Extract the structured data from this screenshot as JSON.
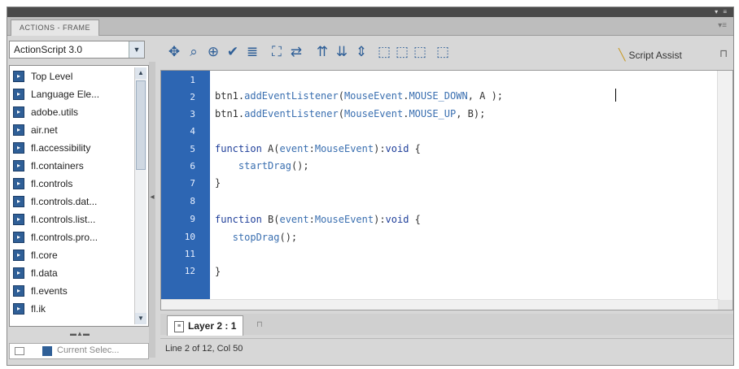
{
  "window": {
    "tab_label": "ACTIONS - FRAME",
    "controls": "▾ ≡",
    "panel_menu": "▾≡"
  },
  "left_panel": {
    "language": "ActionScript 3.0",
    "tree_items": [
      {
        "label": "Top Level"
      },
      {
        "label": "Language Ele..."
      },
      {
        "label": "adobe.utils"
      },
      {
        "label": "air.net"
      },
      {
        "label": "fl.accessibility"
      },
      {
        "label": "fl.containers"
      },
      {
        "label": "fl.controls"
      },
      {
        "label": "fl.controls.dat..."
      },
      {
        "label": "fl.controls.list..."
      },
      {
        "label": "fl.controls.pro..."
      },
      {
        "label": "fl.core"
      },
      {
        "label": "fl.data"
      },
      {
        "label": "fl.events"
      },
      {
        "label": "fl.ik"
      }
    ],
    "bottom_item": "Current Selec..."
  },
  "toolbar": {
    "icons": [
      "add-statement-icon",
      "find-icon",
      "insert-target-path-icon",
      "check-syntax-icon",
      "auto-format-icon",
      "show-code-hint-icon",
      "debug-options-icon",
      "collapse-between-braces-icon",
      "collapse-selection-icon",
      "expand-all-icon",
      "apply-block-comment-icon",
      "apply-line-comment-icon",
      "remove-comment-icon",
      "show-hide-toolbox-icon"
    ],
    "icon_glyphs": [
      "✥",
      "⌕",
      "⊕",
      "✔",
      "≣",
      "⛶",
      "⇄",
      "⇈",
      "⇊",
      "⇕",
      "⬚",
      "⬚",
      "⬚",
      "⬚"
    ],
    "script_assist_label": "Script Assist",
    "pin_glyph": "⊓"
  },
  "editor": {
    "line_numbers": [
      "1",
      "2",
      "3",
      "4",
      "5",
      "6",
      "7",
      "8",
      "9",
      "10",
      "11",
      "12"
    ],
    "lines": [
      "",
      "btn1.addEventListener(MouseEvent.MOUSE_DOWN, A );",
      "btn1.addEventListener(MouseEvent.MOUSE_UP, B);",
      "",
      "function A(event:MouseEvent):void {",
      "    startDrag();",
      "}",
      "",
      "function B(event:MouseEvent):void {",
      "   stopDrag();",
      "",
      "}"
    ]
  },
  "layer_tab": {
    "label": "Layer 2 : 1"
  },
  "status": {
    "text": "Line 2 of 12, Col 50"
  },
  "colors": {
    "gutter": "#2d66b3",
    "keyword": "#1f3f9a",
    "identifier": "#3a6fb0"
  }
}
